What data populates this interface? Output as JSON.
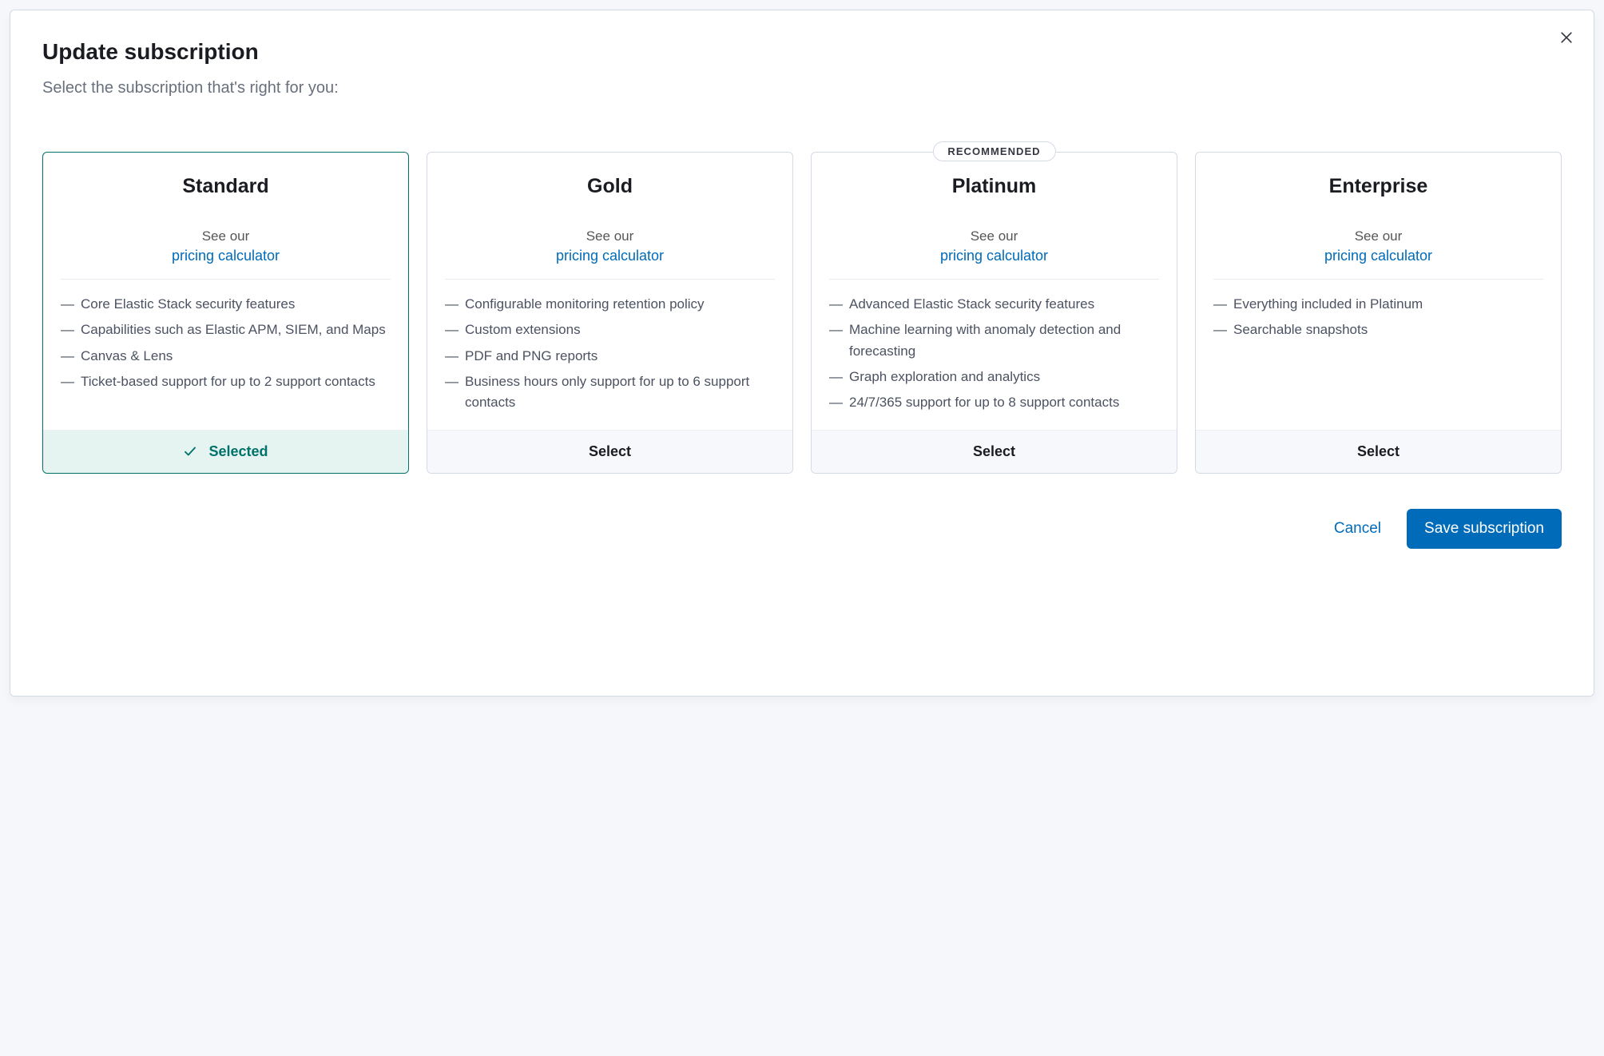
{
  "modal": {
    "title": "Update subscription",
    "subtitle": "Select the subscription that's right for you:",
    "see_our": "See our",
    "pricing_link": "pricing calculator",
    "recommended_label": "RECOMMENDED",
    "selected_label": "Selected",
    "select_label": "Select",
    "cancel": "Cancel",
    "save": "Save subscription"
  },
  "tiers": [
    {
      "name": "Standard",
      "selected": true,
      "recommended": false,
      "features": [
        "Core Elastic Stack security features",
        "Capabilities such as Elastic APM, SIEM, and Maps",
        "Canvas & Lens",
        "Ticket-based support for up to 2 support contacts"
      ]
    },
    {
      "name": "Gold",
      "selected": false,
      "recommended": false,
      "features": [
        "Configurable monitoring retention policy",
        "Custom extensions",
        "PDF and PNG reports",
        "Business hours only support for up to 6 support contacts"
      ]
    },
    {
      "name": "Platinum",
      "selected": false,
      "recommended": true,
      "features": [
        "Advanced Elastic Stack security features",
        "Machine learning with anomaly detection and forecasting",
        "Graph exploration and analytics",
        "24/7/365 support for up to 8 support contacts"
      ]
    },
    {
      "name": "Enterprise",
      "selected": false,
      "recommended": false,
      "features": [
        "Everything included in Platinum",
        "Searchable snapshots"
      ]
    }
  ]
}
